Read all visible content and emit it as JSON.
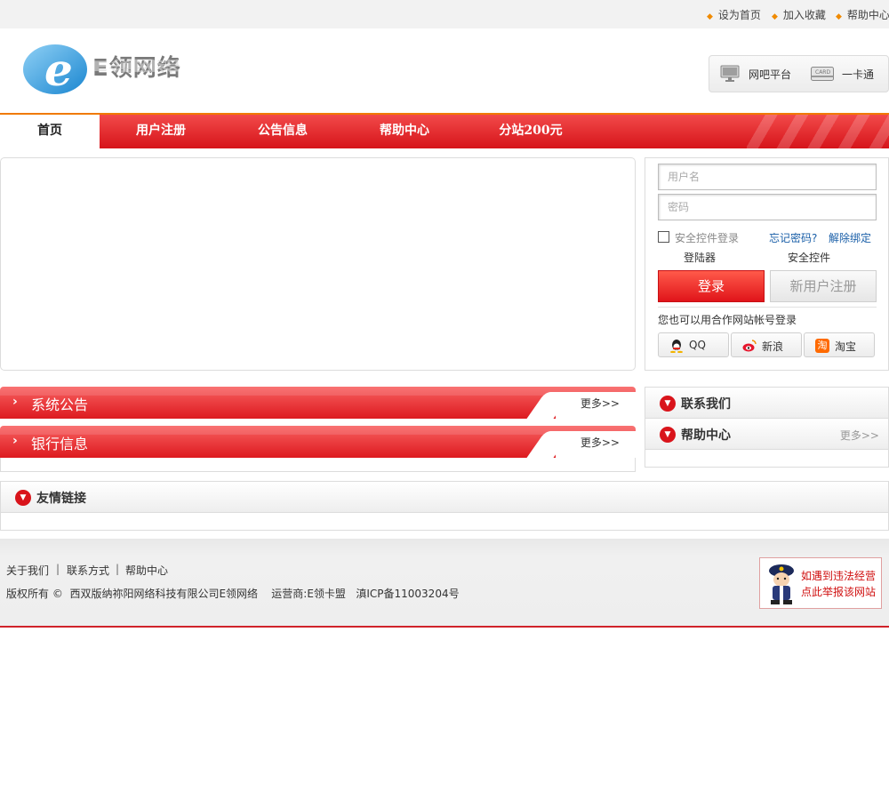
{
  "topbar": {
    "links": [
      "设为首页",
      "加入收藏",
      "帮助中心"
    ]
  },
  "logo": {
    "text": "E领网络"
  },
  "platform": {
    "items": [
      {
        "label": "网吧平台",
        "icon": "monitor-icon"
      },
      {
        "label": "一卡通",
        "icon": "card-icon",
        "card_text": "CARD"
      }
    ]
  },
  "nav": {
    "items": [
      "首页",
      "用户注册",
      "公告信息",
      "帮助中心",
      "分站200元"
    ],
    "active": "首页"
  },
  "login": {
    "username_placeholder": "用户名",
    "password_placeholder": "密码",
    "secure_login": "安全控件登录",
    "forgot": "忘记密码?",
    "unbind": "解除绑定",
    "launcher": "登陆器",
    "secure_control": "安全控件",
    "login_button": "登录",
    "register_button": "新用户注册",
    "partner_text": "您也可以用合作网站帐号登录",
    "partners": [
      {
        "label": "QQ",
        "icon": "qq-icon"
      },
      {
        "label": "新浪",
        "icon": "weibo-icon"
      },
      {
        "label": "淘宝",
        "icon": "taobao-icon",
        "glyph": "淘"
      }
    ]
  },
  "sections": {
    "notice_title": "系统公告",
    "bank_title": "银行信息",
    "more": "更多>>",
    "contact_title": "联系我们",
    "help_title": "帮助中心",
    "links_title": "友情链接"
  },
  "footer": {
    "links": [
      "关于我们",
      "联系方式",
      "帮助中心"
    ],
    "separator": "|",
    "copyright": "版权所有 ©  西双版纳祢阳网络科技有限公司E领网络    运营商:E领卡盟   滇ICP备11003204号",
    "report_line1": "如遇到违法经营",
    "report_line2": "点此举报该网站"
  },
  "colors": {
    "brand_red": "#d9141b",
    "nav_top_border": "#f07a00",
    "link_blue": "#1a5fa8"
  }
}
